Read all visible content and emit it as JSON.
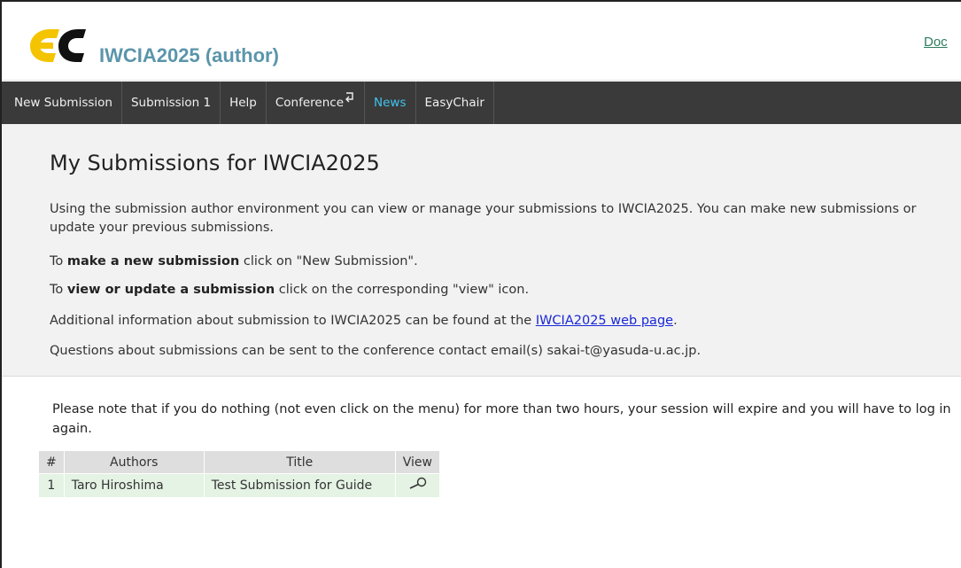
{
  "header": {
    "app_title": "IWCIA2025 (author)",
    "doc_link": "Doc",
    "logo_icon": "easychair-logo",
    "logo_colors": {
      "yellow": "#f5c400",
      "black": "#111111"
    }
  },
  "menu": {
    "items": [
      {
        "label": "New Submission",
        "active": false
      },
      {
        "label": "Submission 1",
        "active": false
      },
      {
        "label": "Help",
        "active": false
      },
      {
        "label": "Conference",
        "active": false,
        "icon": "return-arrow-icon"
      },
      {
        "label": "News",
        "active": true
      },
      {
        "label": "EasyChair",
        "active": false
      }
    ],
    "active_color": "#3ec4ef",
    "background": "#3a3a3a"
  },
  "intro": {
    "title": "My Submissions for IWCIA2025",
    "p1": "Using the submission author environment you can view or manage your submissions to IWCIA2025. You can make new submissions or update your previous submissions.",
    "p2_prefix": "To ",
    "p2_bold": "make a new submission",
    "p2_suffix": " click on \"New Submission\".",
    "p3_prefix": "To ",
    "p3_bold": "view or update a submission",
    "p3_suffix": " click on the corresponding \"view\" icon.",
    "p4_prefix": "Additional information about submission to IWCIA2025 can be found at the ",
    "p4_link": "IWCIA2025 web page",
    "p4_suffix": ".",
    "p5": "Questions about submissions can be sent to the conference contact email(s) sakai-t@yasuda-u.ac.jp."
  },
  "note": "Please note that if you do nothing (not even click on the menu) for more than two hours, your session will expire and you will have to log in again.",
  "table": {
    "headers": [
      "#",
      "Authors",
      "Title",
      "View"
    ],
    "rows": [
      {
        "num": "1",
        "authors": "Taro Hiroshima",
        "title": "Test Submission for Guide",
        "view_icon": "magnifier-icon"
      }
    ]
  }
}
